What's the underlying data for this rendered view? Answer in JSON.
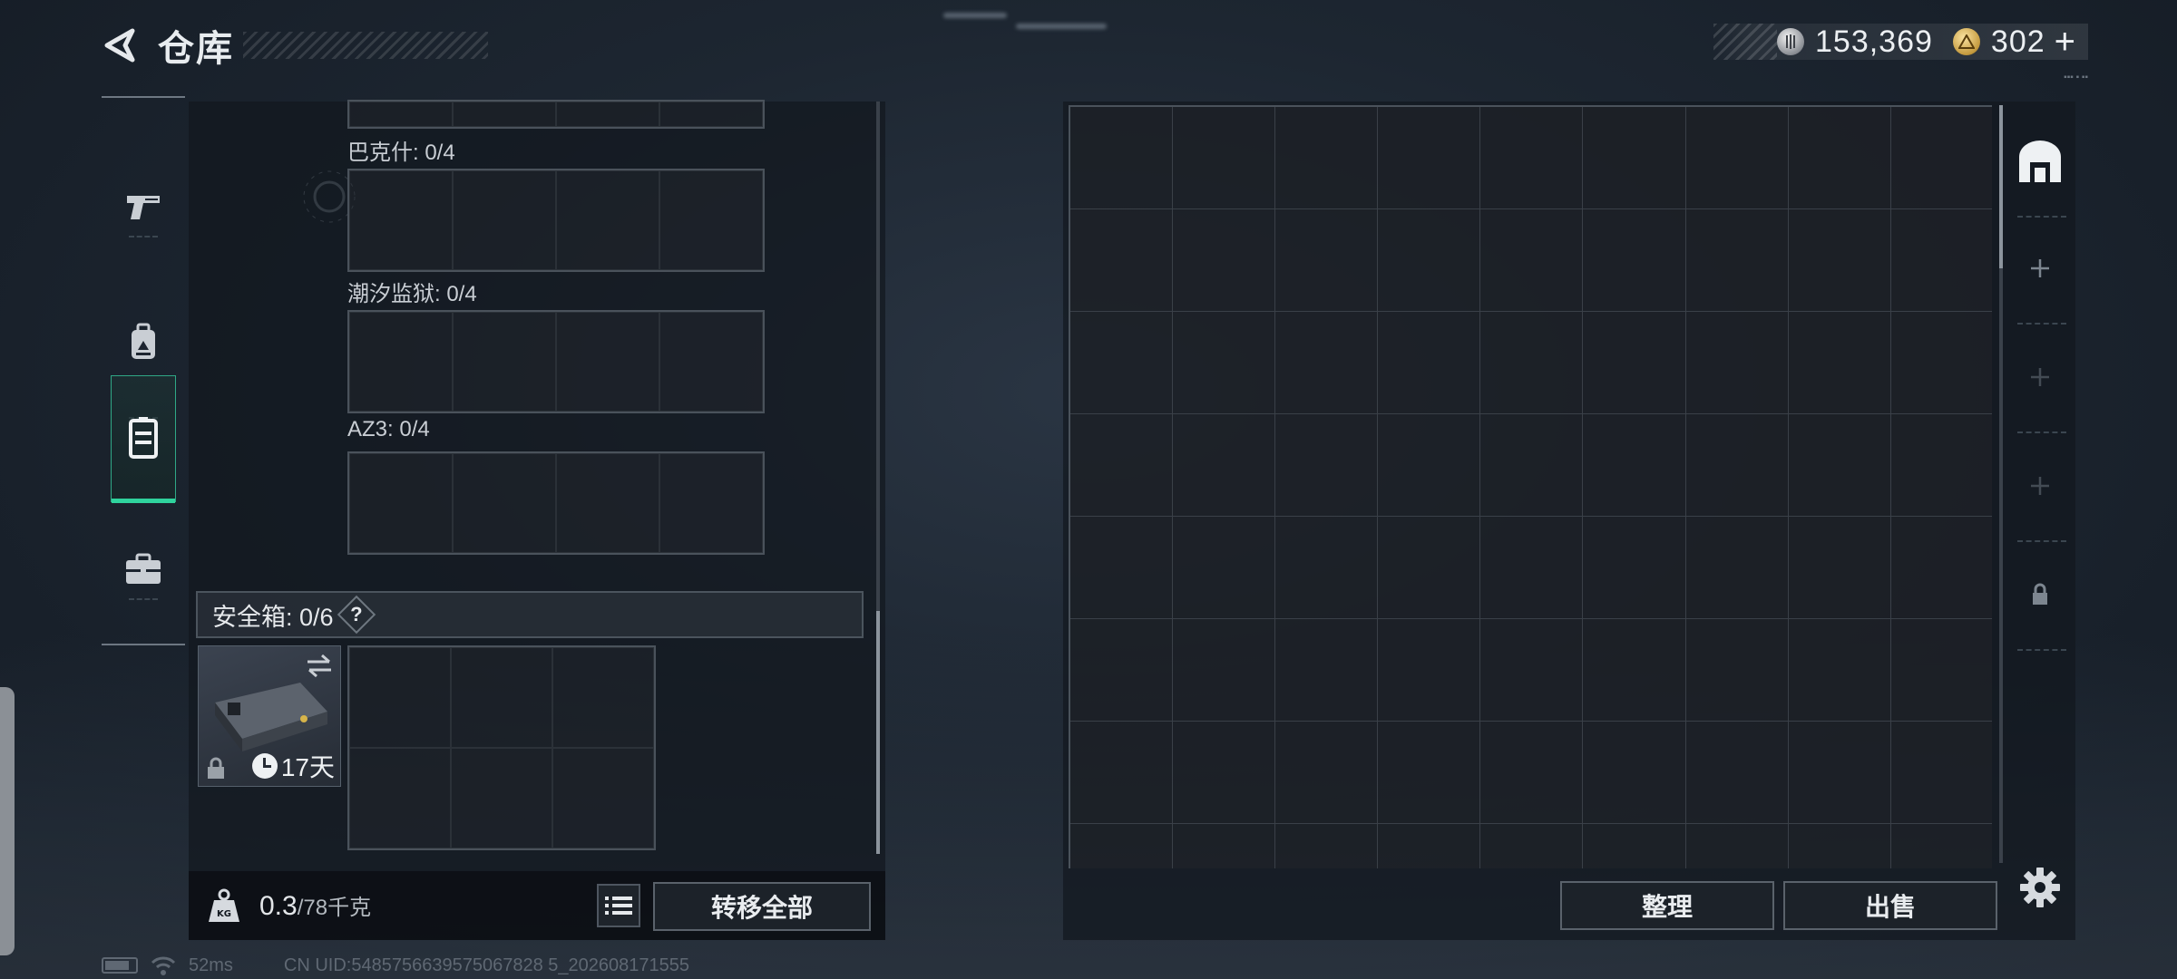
{
  "header": {
    "title": "仓库"
  },
  "currency": {
    "silver_value": "153,369",
    "gold_value": "302",
    "plus_label": "+"
  },
  "side_nav": {
    "items": [
      {
        "icon": "pistol-icon",
        "active": false
      },
      {
        "icon": "backpack-icon",
        "active": false
      },
      {
        "icon": "vest-icon",
        "active": true
      },
      {
        "icon": "briefcase-icon",
        "active": false
      }
    ]
  },
  "containers": [
    {
      "label": "巴克什: 0/4",
      "cells": 4
    },
    {
      "label": "潮汐监狱: 0/4",
      "cells": 4
    },
    {
      "label": "AZ3: 0/4",
      "cells": 4
    }
  ],
  "safe_box": {
    "title": "安全箱: 0/6",
    "help_label": "?",
    "cells": 6,
    "item_timer": "17天"
  },
  "inventory_bar": {
    "weight_current": "0.3",
    "weight_capacity": "/78千克",
    "transfer_all_label": "转移全部"
  },
  "stash": {
    "columns": 9,
    "rows": 8,
    "tabs": [
      {
        "icon": "stash-home-icon",
        "state": "active"
      },
      {
        "icon": "plus-icon",
        "state": "add"
      },
      {
        "icon": "plus-icon",
        "state": "disabled"
      },
      {
        "icon": "plus-icon",
        "state": "disabled"
      },
      {
        "icon": "lock-icon",
        "state": "locked"
      }
    ],
    "sort_label": "整理",
    "sell_label": "出售"
  },
  "status_bar": {
    "ping": "52ms",
    "uid": "CN UID:5485756639575067828 5_202608171555"
  },
  "colors": {
    "accent_green": "#2fd39d",
    "panel_bg": "#12181f"
  }
}
